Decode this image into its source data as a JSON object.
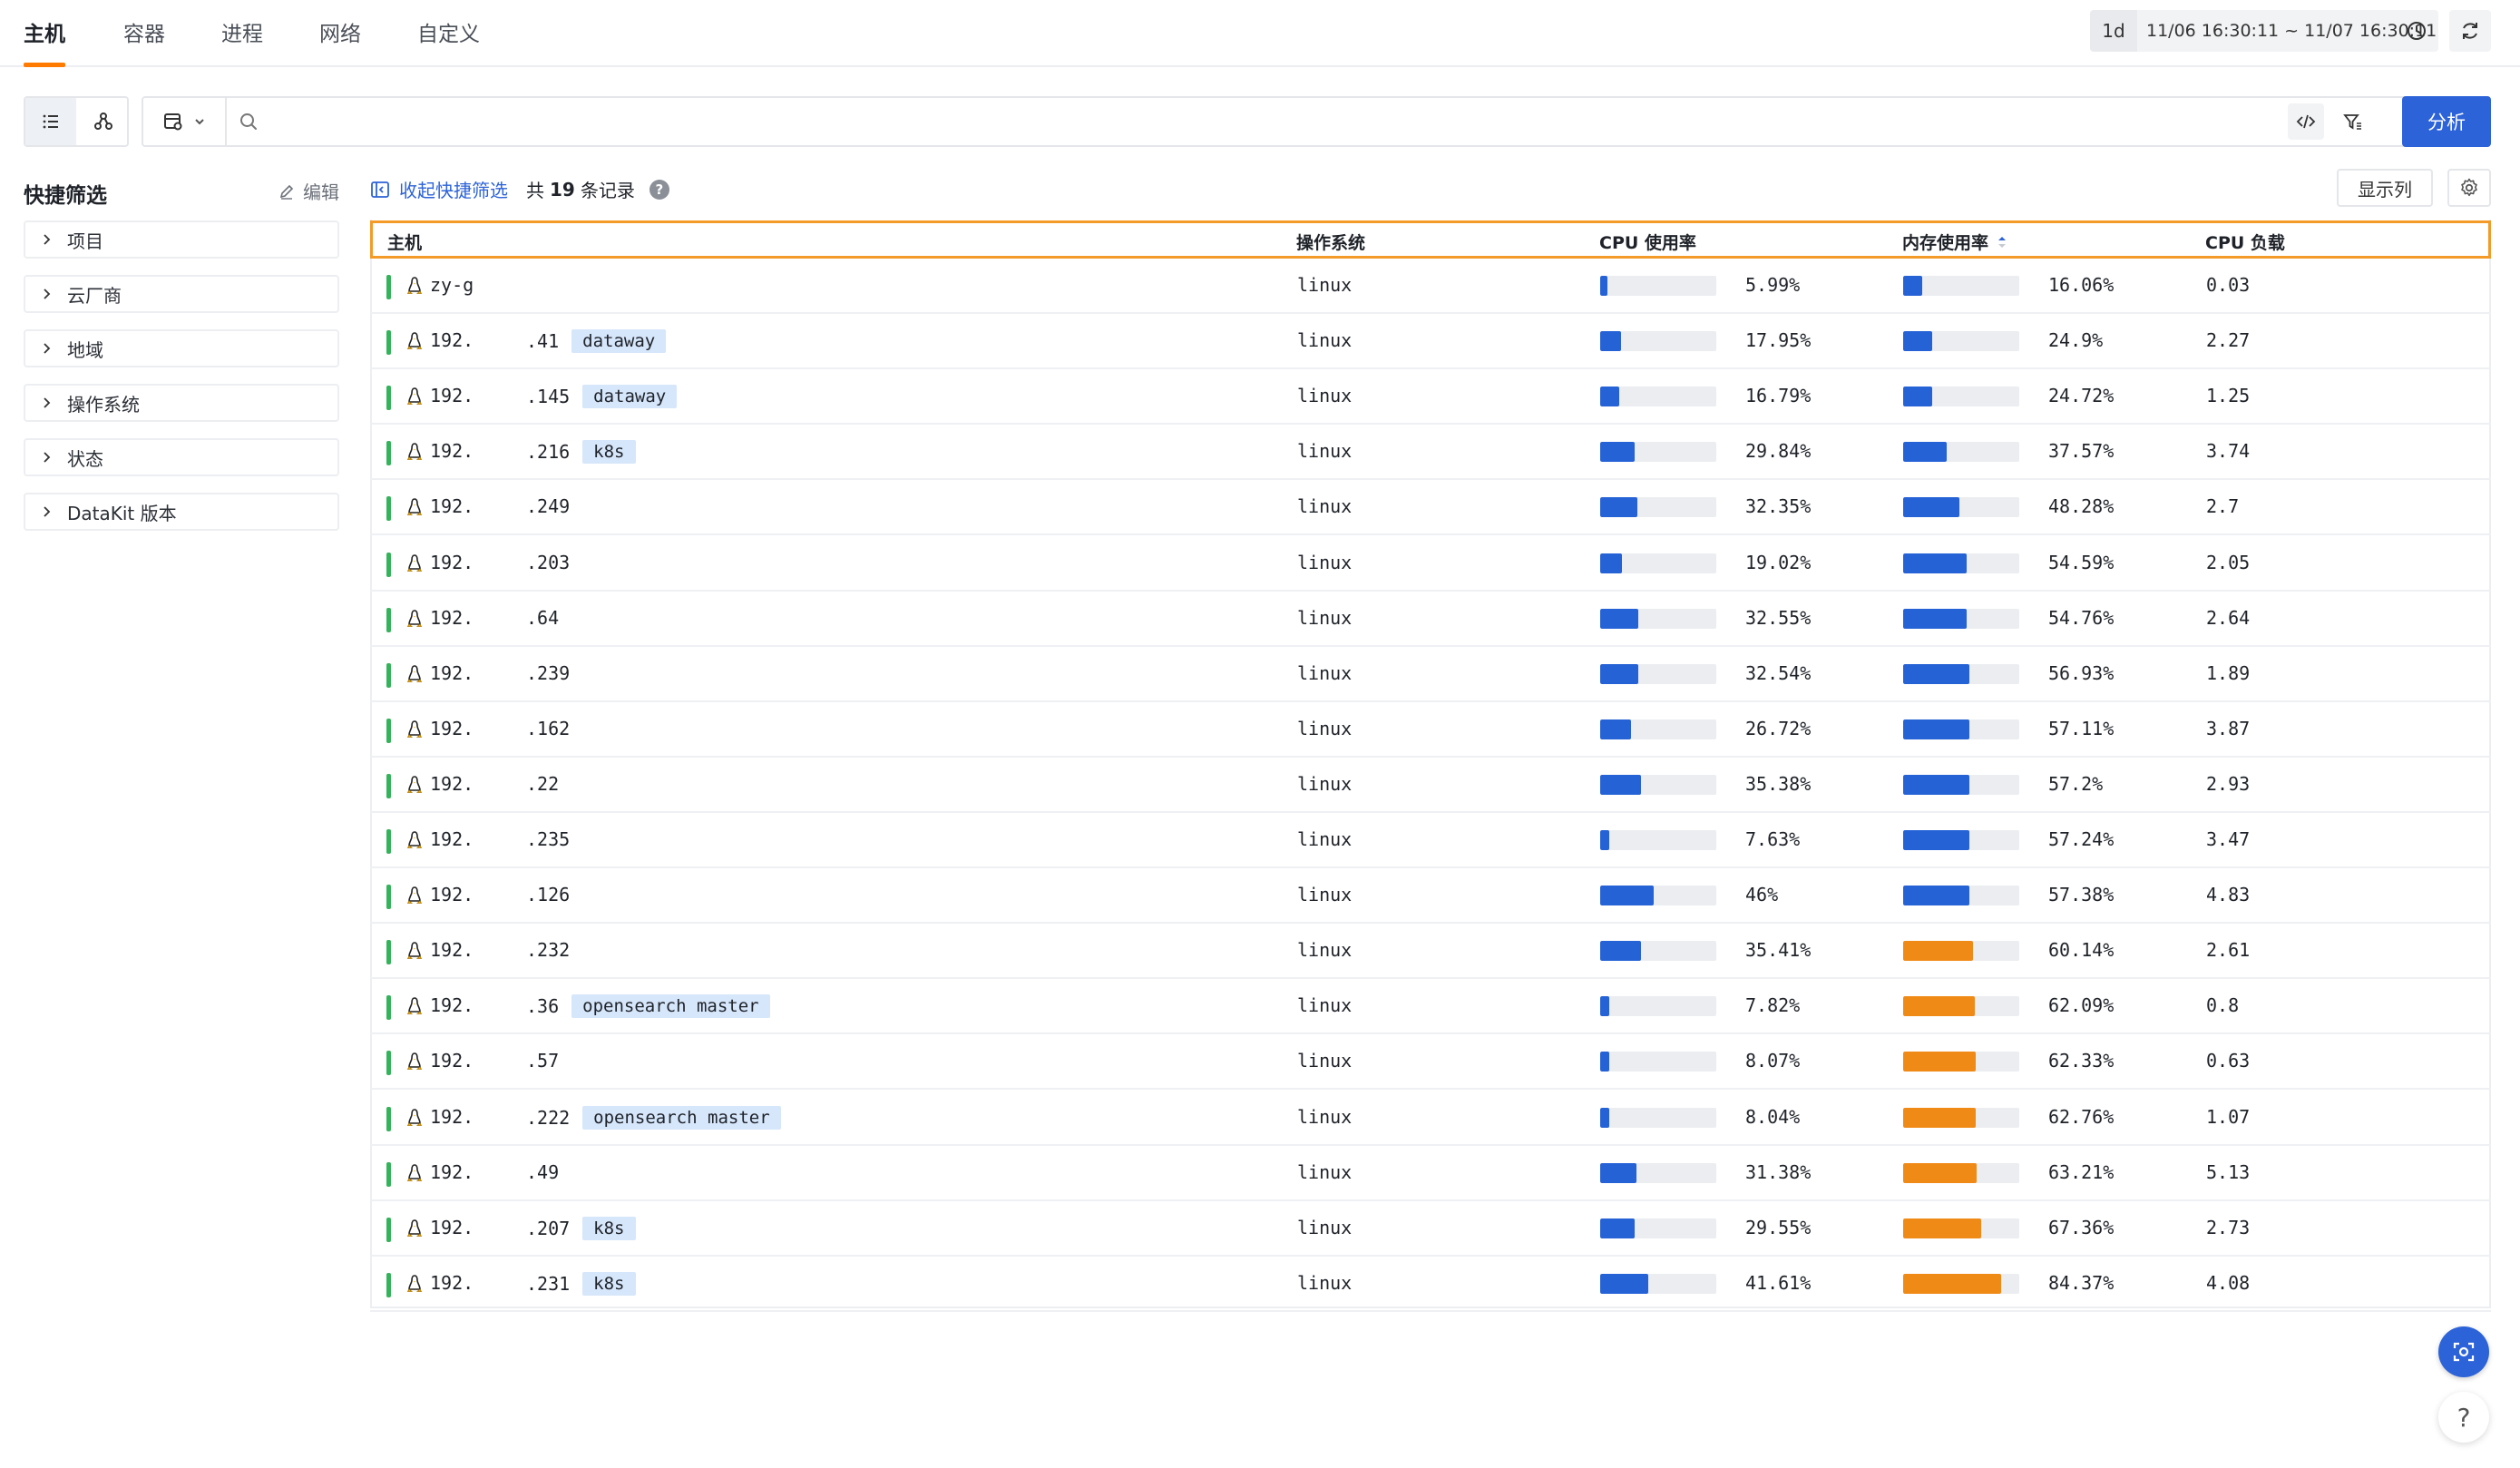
{
  "nav": {
    "tabs": [
      {
        "label": "主机",
        "active": true
      },
      {
        "label": "容器",
        "active": false
      },
      {
        "label": "进程",
        "active": false
      },
      {
        "label": "网络",
        "active": false
      },
      {
        "label": "自定义",
        "active": false
      }
    ],
    "time_key": "1d",
    "time_range": "11/06 16:30:11 ~ 11/07 16:30:11"
  },
  "toolbar": {
    "search_placeholder": "",
    "analyze_label": "分析"
  },
  "quick_filter": {
    "title": "快捷筛选",
    "edit_label": "编辑",
    "items": [
      "项目",
      "云厂商",
      "地域",
      "操作系统",
      "状态",
      "DataKit 版本"
    ]
  },
  "table_meta": {
    "collapse_label": "收起快捷筛选",
    "total_prefix": "共",
    "total_count": "19",
    "total_suffix": "条记录",
    "help_symbol": "?",
    "columns_label": "显示列"
  },
  "columns": {
    "host": "主机",
    "os": "操作系统",
    "cpu": "CPU 使用率",
    "mem": "内存使用率",
    "load": "CPU 负载"
  },
  "colors": {
    "accent": "#2d63d8",
    "tab_underline": "#ff7a00",
    "status_ok": "#35b35a",
    "bar_blue": "#2562d6",
    "bar_orange": "#f08a17",
    "tag_bg": "#d6e6fb"
  },
  "rows": [
    {
      "host_a": "zy-g",
      "host_b": "",
      "tag": "",
      "os": "linux",
      "cpu": "5.99%",
      "cpu_v": 5.99,
      "mem": "16.06%",
      "mem_v": 16.06,
      "load": "0.03"
    },
    {
      "host_a": "192.",
      "host_b": ".41",
      "tag": "dataway",
      "os": "linux",
      "cpu": "17.95%",
      "cpu_v": 17.95,
      "mem": "24.9%",
      "mem_v": 24.9,
      "load": "2.27"
    },
    {
      "host_a": "192.",
      "host_b": ".145",
      "tag": "dataway",
      "os": "linux",
      "cpu": "16.79%",
      "cpu_v": 16.79,
      "mem": "24.72%",
      "mem_v": 24.72,
      "load": "1.25"
    },
    {
      "host_a": "192.",
      "host_b": ".216",
      "tag": "k8s",
      "os": "linux",
      "cpu": "29.84%",
      "cpu_v": 29.84,
      "mem": "37.57%",
      "mem_v": 37.57,
      "load": "3.74"
    },
    {
      "host_a": "192.",
      "host_b": ".249",
      "tag": "",
      "os": "linux",
      "cpu": "32.35%",
      "cpu_v": 32.35,
      "mem": "48.28%",
      "mem_v": 48.28,
      "load": "2.7"
    },
    {
      "host_a": "192.",
      "host_b": ".203",
      "tag": "",
      "os": "linux",
      "cpu": "19.02%",
      "cpu_v": 19.02,
      "mem": "54.59%",
      "mem_v": 54.59,
      "load": "2.05"
    },
    {
      "host_a": "192.",
      "host_b": ".64",
      "tag": "",
      "os": "linux",
      "cpu": "32.55%",
      "cpu_v": 32.55,
      "mem": "54.76%",
      "mem_v": 54.76,
      "load": "2.64"
    },
    {
      "host_a": "192.",
      "host_b": ".239",
      "tag": "",
      "os": "linux",
      "cpu": "32.54%",
      "cpu_v": 32.54,
      "mem": "56.93%",
      "mem_v": 56.93,
      "load": "1.89"
    },
    {
      "host_a": "192.",
      "host_b": ".162",
      "tag": "",
      "os": "linux",
      "cpu": "26.72%",
      "cpu_v": 26.72,
      "mem": "57.11%",
      "mem_v": 57.11,
      "load": "3.87"
    },
    {
      "host_a": "192.",
      "host_b": ".22",
      "tag": "",
      "os": "linux",
      "cpu": "35.38%",
      "cpu_v": 35.38,
      "mem": "57.2%",
      "mem_v": 57.2,
      "load": "2.93"
    },
    {
      "host_a": "192.",
      "host_b": ".235",
      "tag": "",
      "os": "linux",
      "cpu": "7.63%",
      "cpu_v": 7.63,
      "mem": "57.24%",
      "mem_v": 57.24,
      "load": "3.47"
    },
    {
      "host_a": "192.",
      "host_b": ".126",
      "tag": "",
      "os": "linux",
      "cpu": "46%",
      "cpu_v": 46,
      "mem": "57.38%",
      "mem_v": 57.38,
      "load": "4.83"
    },
    {
      "host_a": "192.",
      "host_b": ".232",
      "tag": "",
      "os": "linux",
      "cpu": "35.41%",
      "cpu_v": 35.41,
      "mem": "60.14%",
      "mem_v": 60.14,
      "load": "2.61"
    },
    {
      "host_a": "192.",
      "host_b": ".36",
      "tag": "opensearch master",
      "os": "linux",
      "cpu": "7.82%",
      "cpu_v": 7.82,
      "mem": "62.09%",
      "mem_v": 62.09,
      "load": "0.8"
    },
    {
      "host_a": "192.",
      "host_b": ".57",
      "tag": "",
      "os": "linux",
      "cpu": "8.07%",
      "cpu_v": 8.07,
      "mem": "62.33%",
      "mem_v": 62.33,
      "load": "0.63"
    },
    {
      "host_a": "192.",
      "host_b": ".222",
      "tag": "opensearch master",
      "os": "linux",
      "cpu": "8.04%",
      "cpu_v": 8.04,
      "mem": "62.76%",
      "mem_v": 62.76,
      "load": "1.07"
    },
    {
      "host_a": "192.",
      "host_b": ".49",
      "tag": "",
      "os": "linux",
      "cpu": "31.38%",
      "cpu_v": 31.38,
      "mem": "63.21%",
      "mem_v": 63.21,
      "load": "5.13"
    },
    {
      "host_a": "192.",
      "host_b": ".207",
      "tag": "k8s",
      "os": "linux",
      "cpu": "29.55%",
      "cpu_v": 29.55,
      "mem": "67.36%",
      "mem_v": 67.36,
      "load": "2.73"
    },
    {
      "host_a": "192.",
      "host_b": ".231",
      "tag": "k8s",
      "os": "linux",
      "cpu": "41.61%",
      "cpu_v": 41.61,
      "mem": "84.37%",
      "mem_v": 84.37,
      "load": "4.08"
    }
  ]
}
